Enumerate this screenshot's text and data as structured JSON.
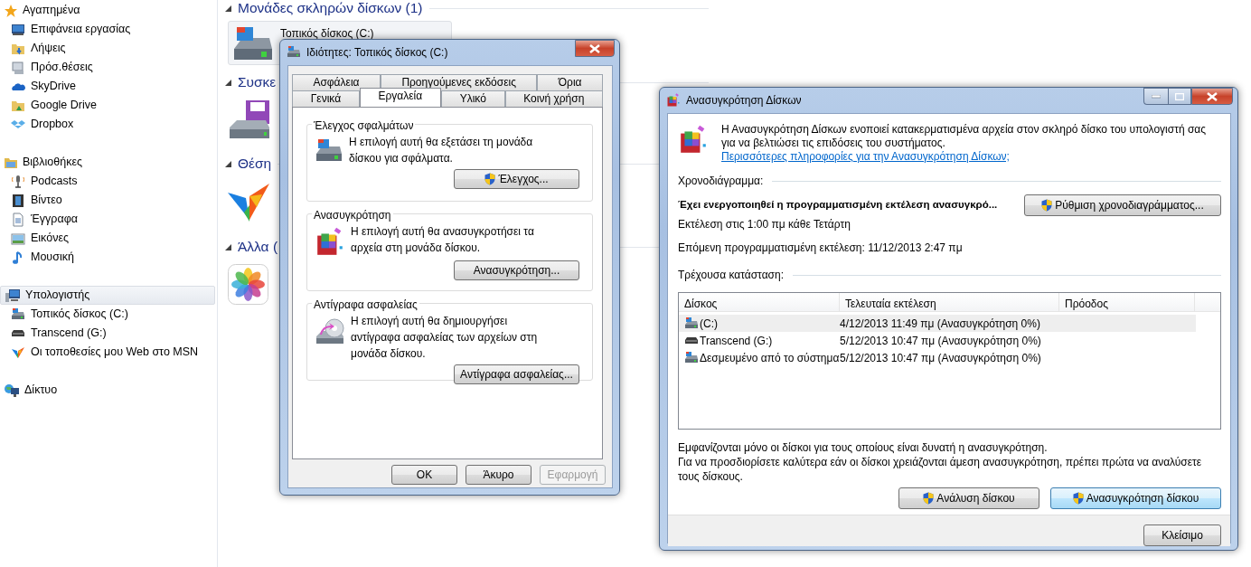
{
  "explorer": {
    "sidebar": {
      "groups": [
        {
          "label": "Αγαπημένα",
          "selected": false,
          "items": [
            {
              "label": "Επιφάνεια εργασίας"
            },
            {
              "label": "Λήψεις"
            },
            {
              "label": "Πρόσ.θέσεις"
            },
            {
              "label": "SkyDrive"
            },
            {
              "label": "Google Drive"
            },
            {
              "label": "Dropbox"
            }
          ]
        },
        {
          "label": "Βιβλιοθήκες",
          "selected": false,
          "items": [
            {
              "label": "Podcasts"
            },
            {
              "label": "Βίντεο"
            },
            {
              "label": "Έγγραφα"
            },
            {
              "label": "Εικόνες"
            },
            {
              "label": "Μουσική"
            }
          ]
        },
        {
          "label": "Υπολογιστής",
          "selected": true,
          "items": [
            {
              "label": "Τοπικός δίσκος (C:)"
            },
            {
              "label": "Transcend (G:)"
            },
            {
              "label": "Οι τοποθεσίες μου Web στο MSN"
            }
          ]
        },
        {
          "label": "Δίκτυο",
          "selected": false
        }
      ]
    },
    "content": {
      "groups": [
        {
          "heading": "Μονάδες σκληρών δίσκων (1)",
          "tiles": [
            {
              "label": "Τοπικός δίσκος (C:)"
            }
          ]
        },
        {
          "heading": "Συσκε"
        },
        {
          "heading": "Θέση"
        },
        {
          "heading": "Άλλα ("
        }
      ]
    }
  },
  "properties_dialog": {
    "title": "Ιδιότητες: Τοπικός δίσκος (C:)",
    "tab_rows": [
      [
        {
          "label": "Ασφάλεια",
          "selected": false
        },
        {
          "label": "Προηγούμενες εκδόσεις",
          "selected": false
        },
        {
          "label": "Όρια",
          "selected": false
        }
      ],
      [
        {
          "label": "Γενικά",
          "selected": false
        },
        {
          "label": "Εργαλεία",
          "selected": true
        },
        {
          "label": "Υλικό",
          "selected": false
        },
        {
          "label": "Κοινή χρήση",
          "selected": false
        }
      ]
    ],
    "sections": [
      {
        "title": "Έλεγχος σφαλμάτων",
        "description": "Η επιλογή αυτή θα εξετάσει τη μονάδα δίσκου για σφάλματα.",
        "button": "Έλεγχος...",
        "shield": true
      },
      {
        "title": "Ανασυγκρότηση",
        "description": "Η επιλογή αυτή θα ανασυγκροτήσει τα αρχεία στη μονάδα δίσκου.",
        "button": "Ανασυγκρότηση...",
        "shield": false
      },
      {
        "title": "Αντίγραφα ασφαλείας",
        "description": "Η επιλογή αυτή θα δημιουργήσει αντίγραφα ασφαλείας των αρχείων στη μονάδα δίσκου.",
        "button": "Αντίγραφα ασφαλείας...",
        "shield": false
      }
    ],
    "buttons": [
      {
        "label": "OK",
        "disabled": false
      },
      {
        "label": "Άκυρο",
        "disabled": false
      },
      {
        "label": "Εφαρμογή",
        "disabled": true
      }
    ]
  },
  "defrag_dialog": {
    "title": "Ανασυγκρότηση Δίσκων",
    "description": "Η Ανασυγκρότηση Δίσκων ενοποιεί κατακερματισμένα αρχεία στον σκληρό δίσκο του υπολογιστή σας για να βελτιώσει τις επιδόσεις του συστήματος.",
    "link": "Περισσότερες πληροφορίες για την Ανασυγκρότηση Δίσκων;",
    "schedule_label": "Χρονοδιάγραμμα:",
    "schedule_status": "Έχει ενεργοποιηθεί η προγραμματισμένη εκτέλεση ανασυγκρό...",
    "schedule_button": "Ρύθμιση χρονοδιαγράμματος...",
    "run_time": "Εκτέλεση στις 1:00 πμ κάθε Τετάρτη",
    "next_run": "Επόμενη προγραμματισμένη εκτέλεση: 11/12/2013 2:47 πμ",
    "status_label": "Τρέχουσα κατάσταση:",
    "table": {
      "columns": [
        "Δίσκος",
        "Τελευταία εκτέλεση",
        "Πρόοδος"
      ],
      "rows": [
        {
          "disk": "(C:)",
          "last_run": "4/12/2013 11:49 πμ (Ανασυγκρότηση 0%)",
          "selected": true
        },
        {
          "disk": "Transcend (G:)",
          "last_run": "5/12/2013 10:47 πμ (Ανασυγκρότηση 0%)",
          "selected": false
        },
        {
          "disk": "Δεσμευμένο από το σύστημα",
          "last_run": "5/12/2013 10:47 πμ (Ανασυγκρότηση 0%)",
          "selected": false
        }
      ]
    },
    "notes": [
      "Εμφανίζονται μόνο οι δίσκοι για τους οποίους είναι δυνατή η ανασυγκρότηση.",
      "Για να προσδιορίσετε καλύτερα εάν οι δίσκοι χρειάζονται άμεση ανασυγκρότηση, πρέπει πρώτα να αναλύσετε τους δίσκους."
    ],
    "actions": [
      {
        "label": "Ανάλυση δίσκου",
        "default": false
      },
      {
        "label": "Ανασυγκρότηση δίσκου",
        "default": true
      }
    ],
    "close_button": "Κλείσιμο"
  }
}
